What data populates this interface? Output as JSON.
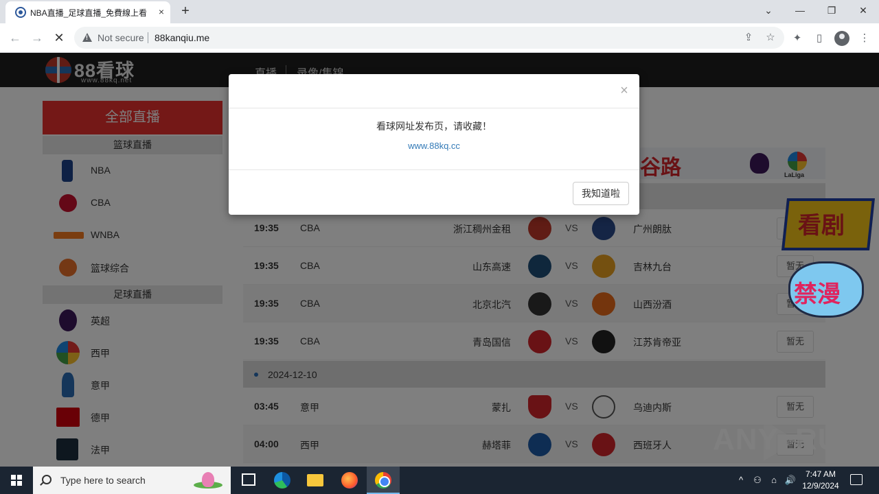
{
  "browser": {
    "tab_title": "NBA直播_足球直播_免費線上看",
    "tab_close": "×",
    "new_tab": "+",
    "window_controls": {
      "minimize": "—",
      "restore": "❐",
      "close": "✕",
      "tab_search": "⌄"
    },
    "back": "←",
    "forward": "→",
    "reload": "✕",
    "security_label": "Not secure",
    "url": "88kanqiu.me",
    "icons": [
      "share-icon",
      "bookmark-star-icon",
      "extensions-icon",
      "side-panel-icon",
      "profile-icon",
      "menu-icon"
    ]
  },
  "site": {
    "logo_text": "88看球",
    "logo_sub": "www.88kq.net",
    "nav": [
      "直播",
      "录像/集锦"
    ]
  },
  "sidebar": {
    "all_live": "全部直播",
    "basketball_header": "篮球直播",
    "basketball_items": [
      {
        "label": "NBA",
        "icon": "nba-logo-icon",
        "color": "#1d428a"
      },
      {
        "label": "CBA",
        "icon": "cba-logo-icon",
        "color": "#c8102e"
      },
      {
        "label": "WNBA",
        "icon": "wnba-logo-icon",
        "color": "#f57b20"
      },
      {
        "label": "篮球综合",
        "icon": "basketball-icon",
        "color": "#e8702a"
      }
    ],
    "football_header": "足球直播",
    "football_items": [
      {
        "label": "英超",
        "icon": "premier-league-icon",
        "color": "#3d195b"
      },
      {
        "label": "西甲",
        "icon": "laliga-icon",
        "color": "#e53935"
      },
      {
        "label": "意甲",
        "icon": "serie-a-icon",
        "color": "#2a6db5"
      },
      {
        "label": "德甲",
        "icon": "bundesliga-icon",
        "color": "#d3010c"
      },
      {
        "label": "法甲",
        "icon": "ligue1-icon",
        "color": "#1c2e3f"
      }
    ]
  },
  "banner": {
    "text": "谷路",
    "laliga_text": "LaLiga"
  },
  "matches_day1": [
    {
      "time": "19:35",
      "league": "CBA",
      "home": "浙江稠州金租",
      "vs": "VS",
      "away": "广州朗肽",
      "button": "暂无",
      "home_color": "#c0392b",
      "away_color": "#2a4a8a"
    },
    {
      "time": "19:35",
      "league": "CBA",
      "home": "山东高速",
      "vs": "VS",
      "away": "吉林九台",
      "button": "暂无",
      "home_color": "#1f4e79",
      "away_color": "#e8a020"
    },
    {
      "time": "19:35",
      "league": "CBA",
      "home": "北京北汽",
      "vs": "VS",
      "away": "山西汾酒",
      "button": "暂无",
      "home_color": "#333333",
      "away_color": "#e86a1a"
    },
    {
      "time": "19:35",
      "league": "CBA",
      "home": "青岛国信",
      "vs": "VS",
      "away": "江苏肯帝亚",
      "button": "暂无",
      "home_color": "#d3242b",
      "away_color": "#222222"
    }
  ],
  "date_row": "2024-12-10",
  "matches_day2": [
    {
      "time": "03:45",
      "league": "意甲",
      "home": "蒙扎",
      "vs": "VS",
      "away": "乌迪内斯",
      "button": "暂无",
      "home_color": "#d3242b",
      "away_color": "#555555"
    },
    {
      "time": "04:00",
      "league": "西甲",
      "home": "赫塔菲",
      "vs": "VS",
      "away": "西班牙人",
      "button": "暂无",
      "home_color": "#1c5aa6",
      "away_color": "#d3242b"
    }
  ],
  "float_ads": [
    "看剧",
    "禁漫"
  ],
  "watermark": {
    "left": "ANY",
    "right": "RUN"
  },
  "modal": {
    "close": "×",
    "message": "看球网址发布页，请收藏！",
    "link": "www.88kq.cc",
    "confirm": "我知道啦"
  },
  "taskbar": {
    "search_placeholder": "Type here to search",
    "time": "7:47 AM",
    "date": "12/9/2024",
    "tray": [
      "^",
      "⚇",
      "⌂",
      "🔊"
    ]
  }
}
